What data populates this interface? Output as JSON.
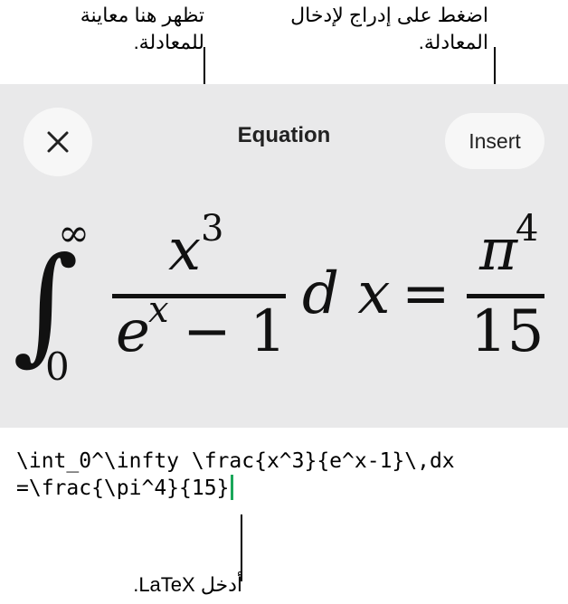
{
  "callouts": {
    "preview_note": "تظهر هنا معاينة للمعادلة.",
    "insert_note": "اضغط على إدراج لإدخال المعادلة.",
    "latex_note": "أدخل LaTeX."
  },
  "sheet": {
    "title": "Equation",
    "insert_label": "Insert",
    "close_icon": "close-icon"
  },
  "preview": {
    "integral_sign": "∫",
    "upper_limit": "∞",
    "lower_limit": "0",
    "numerator_base": "x",
    "numerator_exp": "3",
    "denominator_base": "e",
    "denominator_exp": "x",
    "denominator_rest": "− 1",
    "differential": "d x",
    "equals": "=",
    "rhs_numerator_base": "π",
    "rhs_numerator_exp": "4",
    "rhs_denominator": "15"
  },
  "editor": {
    "latex_line1": "\\int_0^\\infty \\frac{x^3}{e^x-1}\\,dx",
    "latex_line2": "=\\frac{\\pi^4}{15}"
  },
  "colors": {
    "sheet_bg": "#e9e9ea",
    "button_bg": "#f7f7f7",
    "caret": "#1aa75a"
  }
}
